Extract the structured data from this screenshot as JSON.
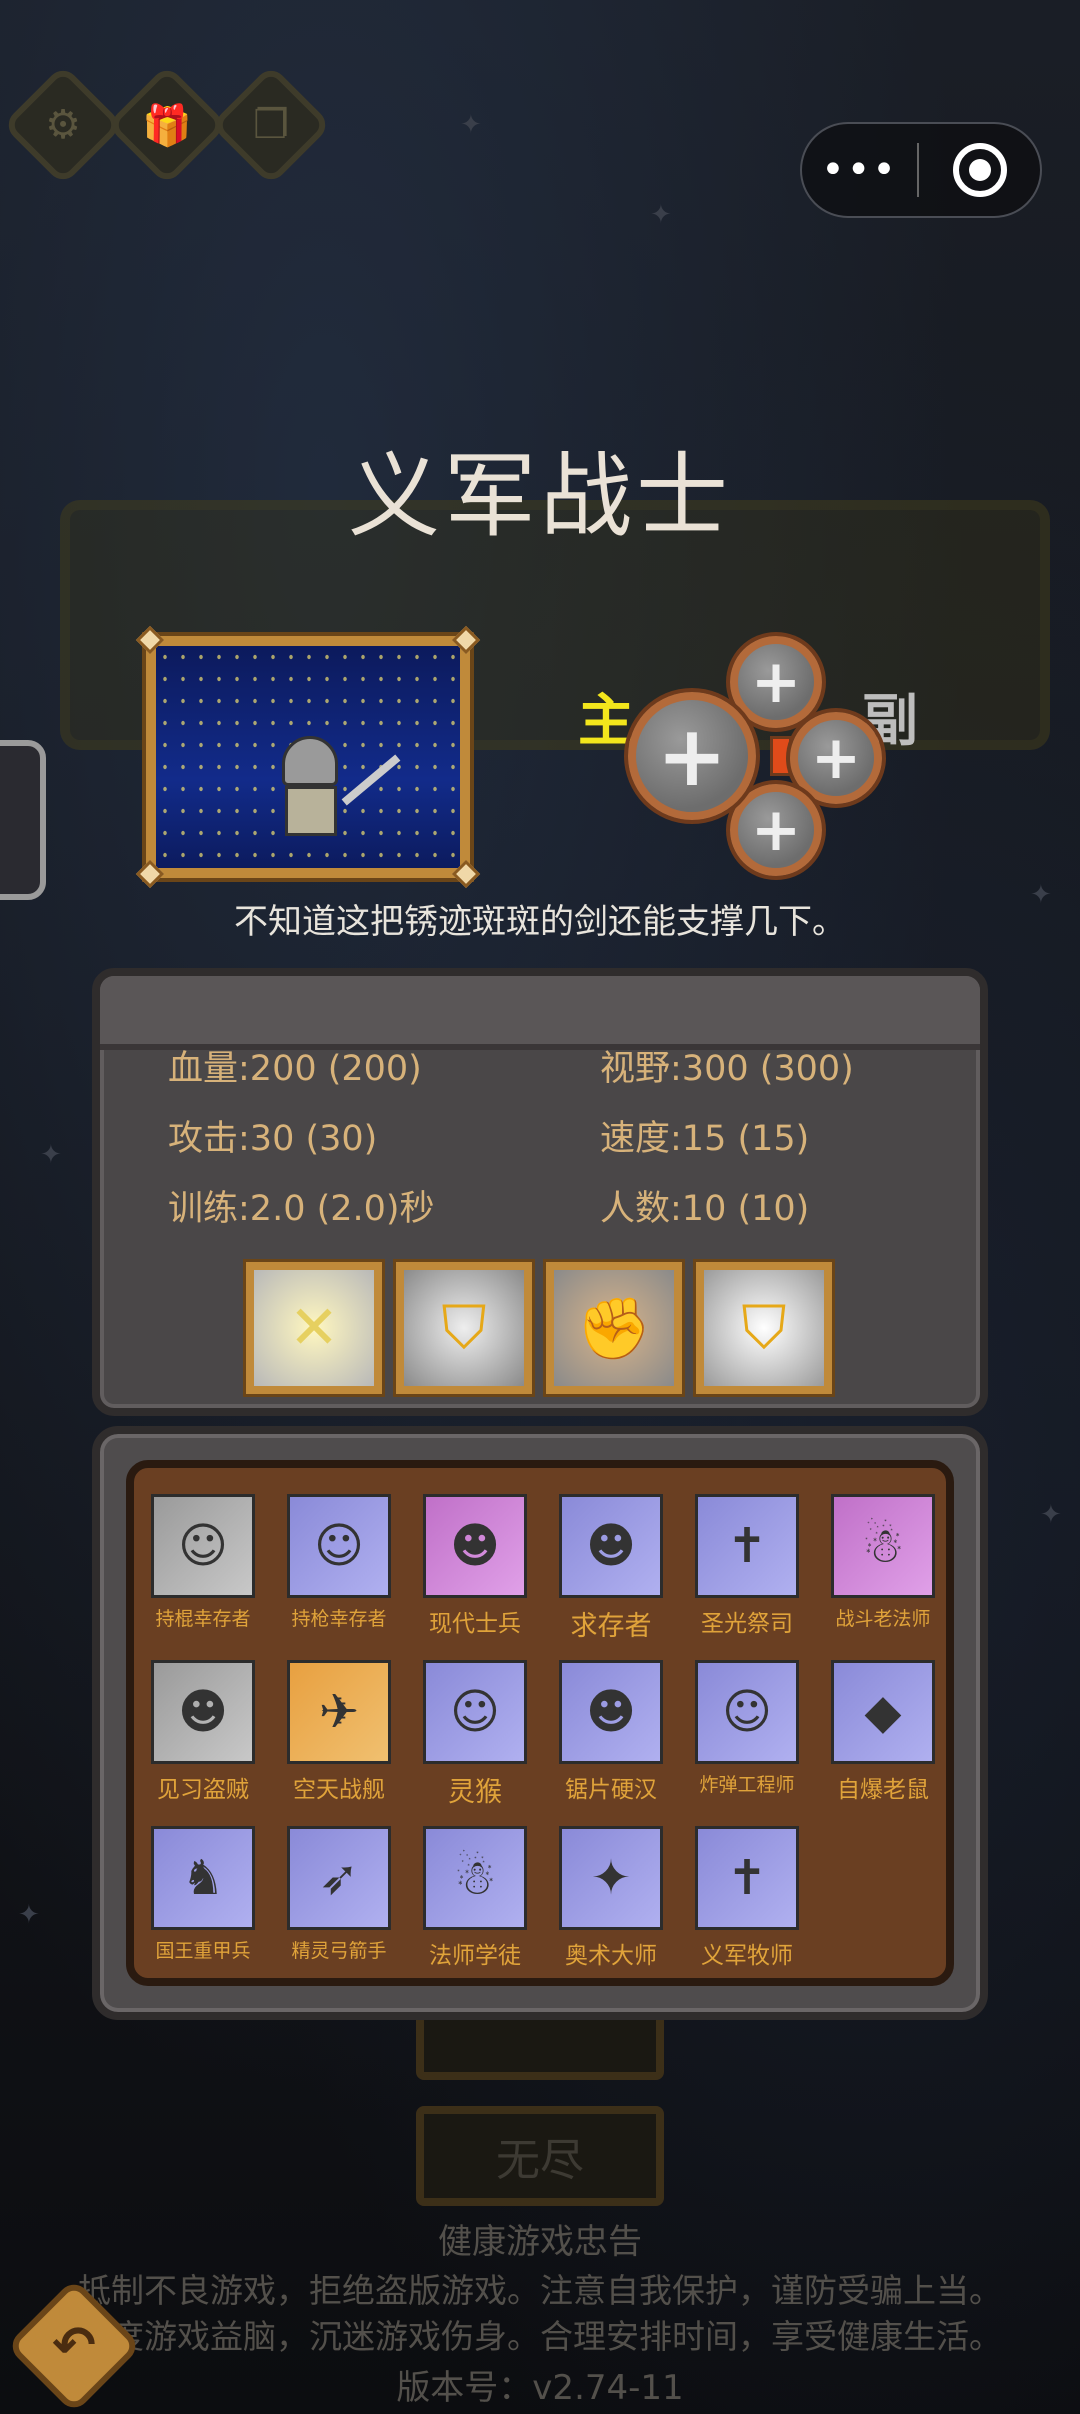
{
  "top_buttons": [
    {
      "icon": "gear-icon",
      "glyph": "⚙"
    },
    {
      "icon": "gift-icon",
      "glyph": "🎁"
    },
    {
      "icon": "copy-icon",
      "glyph": "❐"
    }
  ],
  "capsule": {
    "more": "•••",
    "close_icon": "target-icon"
  },
  "unit": {
    "name": "义军战士",
    "description": "不知道这把锈迹斑斑的剑还能支撑几下。"
  },
  "slots": {
    "main_label": "主",
    "sub_label": "副",
    "plus": "+"
  },
  "stats": [
    {
      "label": "血量:",
      "value": "200 (200)"
    },
    {
      "label": "视野:",
      "value": "300 (300)"
    },
    {
      "label": "攻击:",
      "value": "30 (30)"
    },
    {
      "label": "速度:",
      "value": "15 (15)"
    },
    {
      "label": "训练:",
      "value": "2.0 (2.0)秒"
    },
    {
      "label": "人数:",
      "value": "10 (10)"
    }
  ],
  "abilities": [
    {
      "icon": "crossed-slash-icon",
      "glyph": "✕"
    },
    {
      "icon": "shield-icon",
      "glyph": "⛉"
    },
    {
      "icon": "muscle-icon",
      "glyph": "✊"
    },
    {
      "icon": "shield-glow-icon",
      "glyph": "⛉"
    }
  ],
  "roster": [
    {
      "name": "持棍幸存者",
      "glyph": "☺",
      "bg": "grey",
      "size": "s"
    },
    {
      "name": "持枪幸存者",
      "glyph": "☺",
      "bg": "blue",
      "size": "s"
    },
    {
      "name": "现代士兵",
      "glyph": "☻",
      "bg": "pink",
      "size": "m"
    },
    {
      "name": "求存者",
      "glyph": "☻",
      "bg": "blue",
      "size": "l"
    },
    {
      "name": "圣光祭司",
      "glyph": "✝",
      "bg": "blue",
      "size": "m"
    },
    {
      "name": "战斗老法师",
      "glyph": "☃",
      "bg": "pink",
      "size": "s"
    },
    {
      "name": "见习盗贼",
      "glyph": "☻",
      "bg": "grey",
      "size": "m"
    },
    {
      "name": "空天战舰",
      "glyph": "✈",
      "bg": "orange",
      "size": "m"
    },
    {
      "name": "灵猴",
      "glyph": "☺",
      "bg": "blue",
      "size": "l"
    },
    {
      "name": "锯片硬汉",
      "glyph": "☻",
      "bg": "blue",
      "size": "m"
    },
    {
      "name": "炸弹工程师",
      "glyph": "☺",
      "bg": "blue",
      "size": "s"
    },
    {
      "name": "自爆老鼠",
      "glyph": "◆",
      "bg": "blue",
      "size": "m"
    },
    {
      "name": "国王重甲兵",
      "glyph": "♞",
      "bg": "blue",
      "size": "s"
    },
    {
      "name": "精灵弓箭手",
      "glyph": "➶",
      "bg": "blue",
      "size": "s"
    },
    {
      "name": "法师学徒",
      "glyph": "☃",
      "bg": "blue",
      "size": "m"
    },
    {
      "name": "奥术大师",
      "glyph": "✦",
      "bg": "blue",
      "size": "m"
    },
    {
      "name": "义军牧师",
      "glyph": "✝",
      "bg": "blue",
      "size": "m"
    }
  ],
  "menu_under": {
    "endless": "无尽"
  },
  "health_notice": {
    "title": "健康游戏忠告",
    "line1": "抵制不良游戏，拒绝盗版游戏。注意自我保护，谨防受骗上当。",
    "line2": "适度游戏益脑，沉迷游戏伤身。合理安排时间，享受健康生活。",
    "version": "版本号：v2.74-11"
  },
  "back_button": {
    "icon": "back-arrow-icon",
    "glyph": "↶"
  }
}
